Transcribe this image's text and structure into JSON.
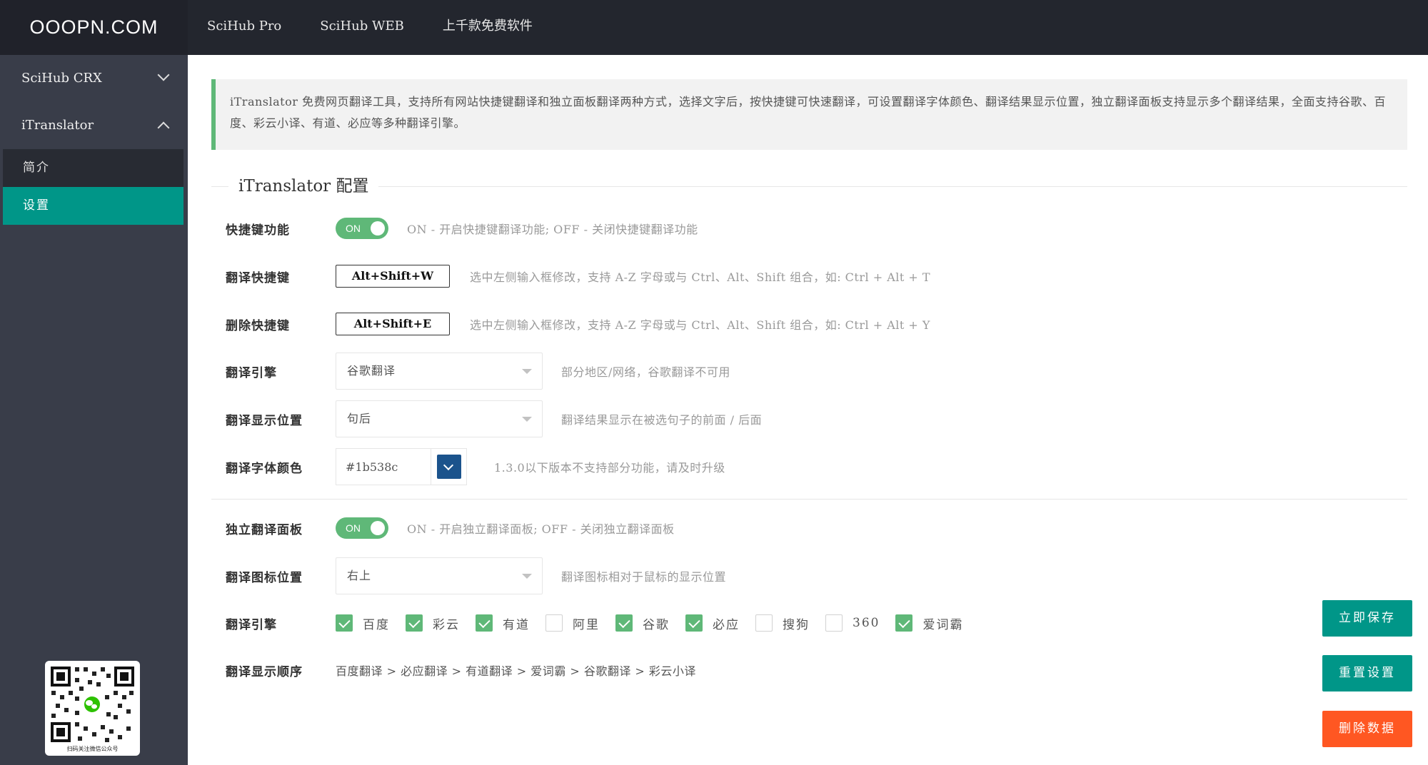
{
  "brand": {
    "logo": "OOOPN.COM"
  },
  "topnav": [
    {
      "label": "SciHub Pro"
    },
    {
      "label": "SciHub WEB"
    },
    {
      "label": "上千款免费软件"
    }
  ],
  "sidebar": {
    "groups": [
      {
        "label": "SciHub CRX",
        "expanded": false
      },
      {
        "label": "iTranslator",
        "expanded": true,
        "items": [
          {
            "label": "简介",
            "active": false
          },
          {
            "label": "设置",
            "active": true
          }
        ]
      }
    ],
    "qr_caption": "扫码关注微信公众号"
  },
  "notice": "iTranslator 免费网页翻译工具，支持所有网站快捷键翻译和独立面板翻译两种方式，选择文字后，按快捷键可快速翻译，可设置翻译字体颜色、翻译结果显示位置，独立翻译面板支持显示多个翻译结果，全面支持谷歌、百度、彩云小译、有道、必应等多种翻译引擎。",
  "section_title": "iTranslator 配置",
  "settings": {
    "hotkey_feature": {
      "label": "快捷键功能",
      "state": "ON",
      "hint": "ON - 开启快捷键翻译功能; OFF - 关闭快捷键翻译功能"
    },
    "translate_hotkey": {
      "label": "翻译快捷键",
      "value": "Alt+Shift+W",
      "hint": "选中左侧输入框修改，支持 A-Z 字母或与 Ctrl、Alt、Shift 组合，如: Ctrl + Alt + T"
    },
    "delete_hotkey": {
      "label": "删除快捷键",
      "value": "Alt+Shift+E",
      "hint": "选中左侧输入框修改，支持 A-Z 字母或与 Ctrl、Alt、Shift 组合，如: Ctrl + Alt + Y"
    },
    "engine": {
      "label": "翻译引擎",
      "value": "谷歌翻译",
      "hint": "部分地区/网络，谷歌翻译不可用"
    },
    "display_position": {
      "label": "翻译显示位置",
      "value": "句后",
      "hint": "翻译结果显示在被选句子的前面 / 后面"
    },
    "font_color": {
      "label": "翻译字体颜色",
      "value": "#1b538c",
      "swatch": "#1b538c",
      "hint": "1.3.0以下版本不支持部分功能，请及时升级"
    },
    "panel": {
      "label": "独立翻译面板",
      "state": "ON",
      "hint": "ON - 开启独立翻译面板; OFF - 关闭独立翻译面板"
    },
    "icon_position": {
      "label": "翻译图标位置",
      "value": "右上",
      "hint": "翻译图标相对于鼠标的显示位置"
    },
    "engines": {
      "label": "翻译引擎",
      "options": [
        {
          "label": "百度",
          "checked": true
        },
        {
          "label": "彩云",
          "checked": true
        },
        {
          "label": "有道",
          "checked": true
        },
        {
          "label": "阿里",
          "checked": false
        },
        {
          "label": "谷歌",
          "checked": true
        },
        {
          "label": "必应",
          "checked": true
        },
        {
          "label": "搜狗",
          "checked": false
        },
        {
          "label": "360",
          "checked": false
        },
        {
          "label": "爱词霸",
          "checked": true
        }
      ]
    },
    "order": {
      "label": "翻译显示顺序",
      "value": "百度翻译 > 必应翻译 > 有道翻译 > 爱词霸 > 谷歌翻译 > 彩云小译"
    }
  },
  "actions": {
    "save": "立即保存",
    "reset": "重置设置",
    "delete": "删除数据"
  },
  "colors": {
    "accent": "#009688",
    "switch": "#5fb878",
    "danger": "#ff5722",
    "sidebar": "#393d49",
    "topbar": "#23262e"
  }
}
